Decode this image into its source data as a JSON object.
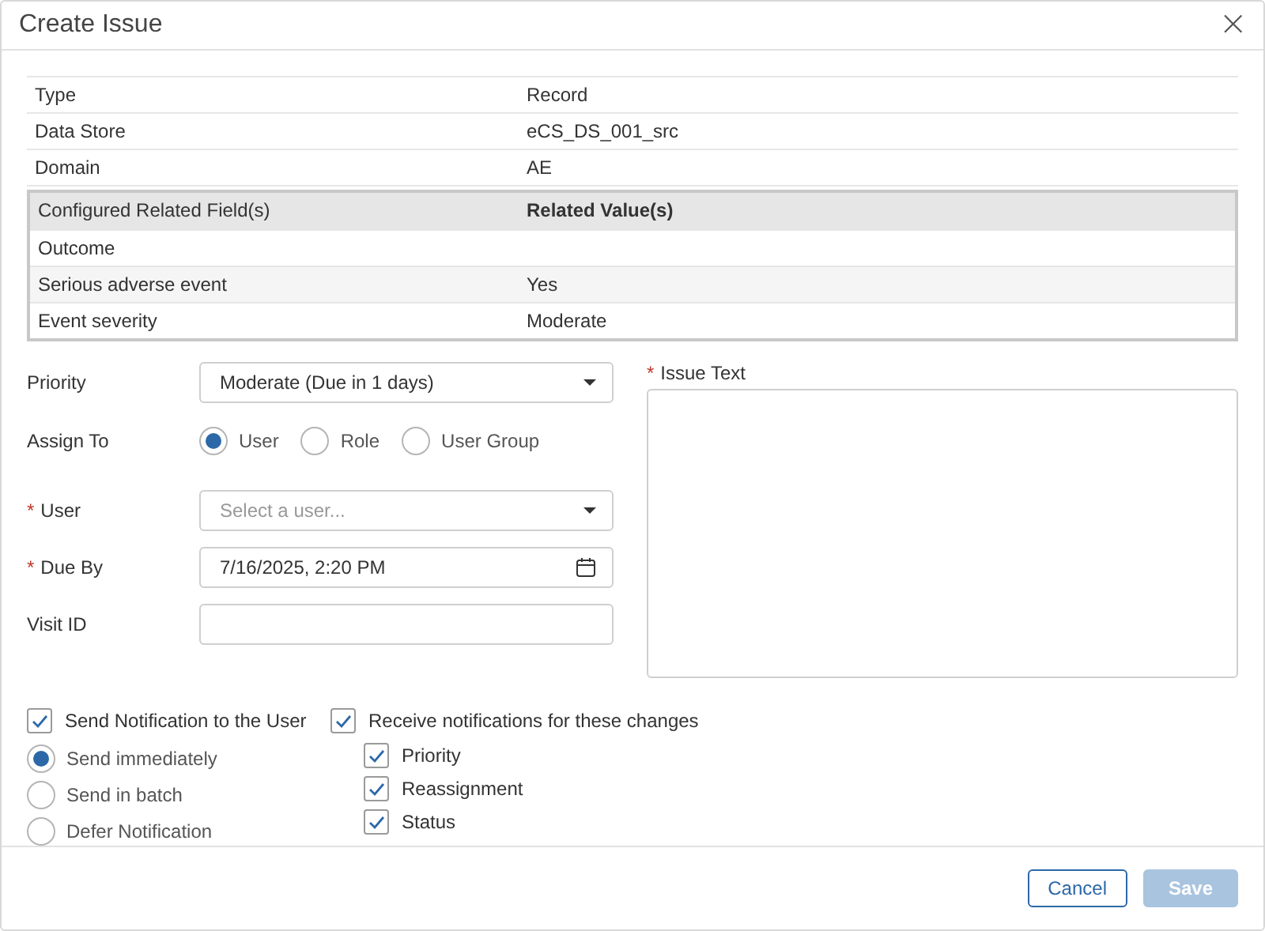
{
  "dialog": {
    "title": "Create Issue",
    "close": "×"
  },
  "info_rows": [
    {
      "label": "Type",
      "value": "Record"
    },
    {
      "label": "Data Store",
      "value": "eCS_DS_001_src"
    },
    {
      "label": "Domain",
      "value": "AE"
    }
  ],
  "related_table": {
    "columns": [
      "Configured Related Field(s)",
      "Related Value(s)"
    ],
    "rows": [
      {
        "field": "Outcome",
        "value": ""
      },
      {
        "field": "Serious adverse event",
        "value": "Yes"
      },
      {
        "field": "Event severity",
        "value": "Moderate"
      }
    ]
  },
  "priority": {
    "label": "Priority",
    "value": "Moderate (Due in 1 days)"
  },
  "assign_to": {
    "label": "Assign To",
    "options": [
      {
        "label": "User",
        "selected": true
      },
      {
        "label": "Role",
        "selected": false
      },
      {
        "label": "User Group",
        "selected": false
      }
    ]
  },
  "user": {
    "label": "User",
    "required_mark": "*",
    "placeholder": "Select a user..."
  },
  "due_by": {
    "label": "Due By",
    "required_mark": "*",
    "value": "7/16/2025, 2:20 PM"
  },
  "visit_id": {
    "label": "Visit ID"
  },
  "issue_text": {
    "label": "Issue Text",
    "required_mark": "*"
  },
  "send_notification": {
    "label": "Send Notification to the User",
    "checked": true
  },
  "delivery": [
    {
      "label": "Send immediately",
      "selected": true
    },
    {
      "label": "Send in batch",
      "selected": false
    },
    {
      "label": "Defer Notification",
      "selected": false
    }
  ],
  "receive": {
    "label": "Receive notifications for these changes",
    "checked": true,
    "items": [
      {
        "label": "Priority",
        "checked": true
      },
      {
        "label": "Reassignment",
        "checked": true
      },
      {
        "label": "Status",
        "checked": true
      }
    ]
  },
  "buttons": [
    {
      "kind": "secondary",
      "label": "Cancel",
      "disabled": false
    },
    {
      "kind": "primary",
      "label": "Save",
      "disabled": true
    }
  ]
}
